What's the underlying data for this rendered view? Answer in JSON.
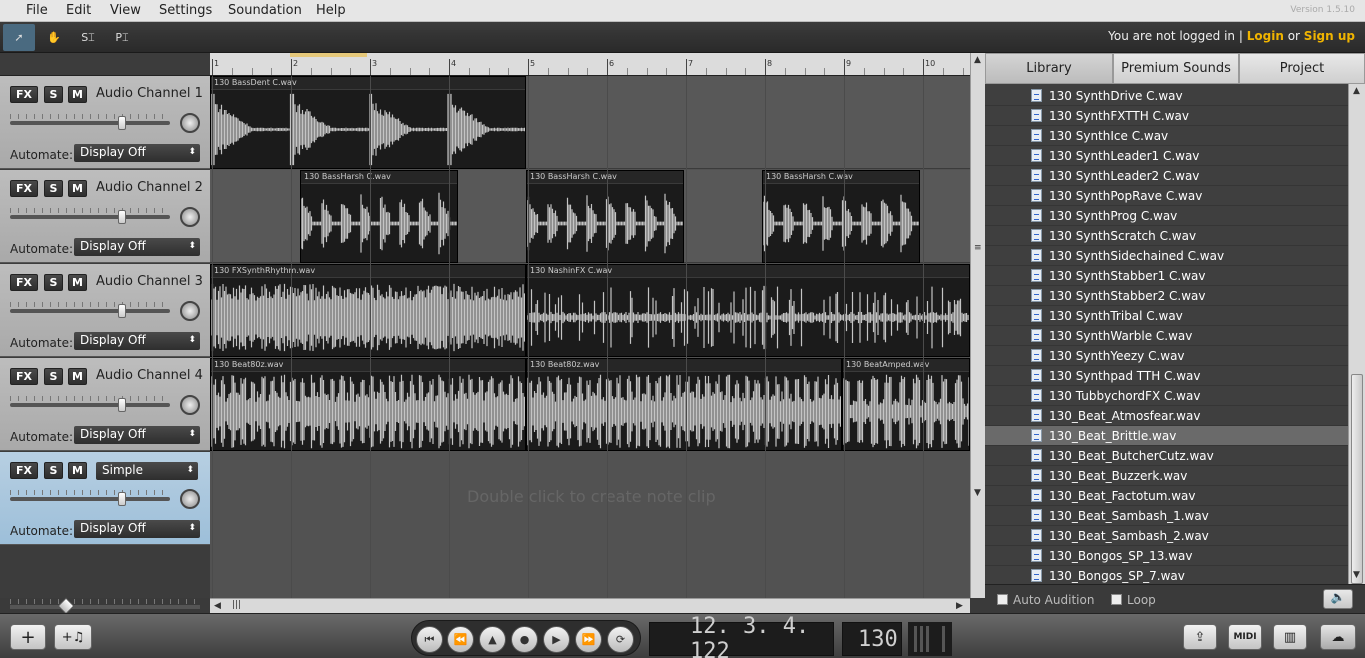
{
  "menu": [
    "File",
    "Edit",
    "View",
    "Settings",
    "Soundation",
    "Help"
  ],
  "version": "Version 1.5.10",
  "toolbar": {
    "tools": [
      {
        "name": "pointer-tool",
        "glyph": "➚"
      },
      {
        "name": "hand-tool",
        "glyph": "✋"
      },
      {
        "name": "split-tool",
        "glyph": "S⌶"
      },
      {
        "name": "paste-tool",
        "glyph": "P⌶"
      }
    ]
  },
  "login": {
    "text": "You are not logged in |",
    "login": "Login",
    "or": "or",
    "signup": "Sign up"
  },
  "channels": [
    {
      "name": "Audio Channel 1",
      "automate": "Display Off"
    },
    {
      "name": "Audio Channel 2",
      "automate": "Display Off"
    },
    {
      "name": "Audio Channel 3",
      "automate": "Display Off"
    },
    {
      "name": "Audio Channel 4",
      "automate": "Display Off"
    },
    {
      "instrument": "Simple",
      "automate": "Display Off"
    }
  ],
  "channel_labels": {
    "fx": "FX",
    "solo": "S",
    "mute": "M",
    "automate": "Automate:"
  },
  "ruler": [
    "1",
    "2",
    "3",
    "4",
    "5",
    "6",
    "7",
    "8",
    "9",
    "10"
  ],
  "clips": [
    {
      "lane": 0,
      "title": "130 BassDent C.wav"
    },
    {
      "lane": 1,
      "title": "130 BassHarsh C.wav"
    },
    {
      "lane": 1,
      "title": "130 BassHarsh C.wav"
    },
    {
      "lane": 1,
      "title": "130 BassHarsh C.wav"
    },
    {
      "lane": 2,
      "title": "130 FXSynthRhythm.wav"
    },
    {
      "lane": 2,
      "title": "130 NashinFX C.wav"
    },
    {
      "lane": 3,
      "title": "130 Beat80z.wav"
    },
    {
      "lane": 3,
      "title": "130 Beat80z.wav"
    },
    {
      "lane": 3,
      "title": "130 BeatAmped.wav"
    }
  ],
  "hint": "Double click to create note clip",
  "library": {
    "tabs": [
      "Library",
      "Premium Sounds",
      "Project"
    ],
    "files": [
      "130 SynthDrive C.wav",
      "130 SynthFXTTH C.wav",
      "130 SynthIce C.wav",
      "130 SynthLeader1 C.wav",
      "130 SynthLeader2 C.wav",
      "130 SynthPopRave C.wav",
      "130 SynthProg C.wav",
      "130 SynthScratch C.wav",
      "130 SynthSidechained C.wav",
      "130 SynthStabber1 C.wav",
      "130 SynthStabber2 C.wav",
      "130 SynthTribal C.wav",
      "130 SynthWarble C.wav",
      "130 SynthYeezy C.wav",
      "130 Synthpad TTH C.wav",
      "130 TubbychordFX C.wav",
      "130_Beat_Atmosfear.wav",
      "130_Beat_Brittle.wav",
      "130_Beat_ButcherCutz.wav",
      "130_Beat_Buzzerk.wav",
      "130_Beat_Factotum.wav",
      "130_Beat_Sambash_1.wav",
      "130_Beat_Sambash_2.wav",
      "130_Bongos_SP_13.wav",
      "130_Bongos_SP_7.wav"
    ],
    "selected_file": "130_Beat_Brittle.wav",
    "auto_audition": "Auto Audition",
    "loop": "Loop"
  },
  "transport": {
    "position": "12. 3. 4. 122",
    "tempo": "130"
  },
  "bottom": {
    "add_channel": "+",
    "add_instrument": "+♫",
    "midi": "MIDI"
  }
}
